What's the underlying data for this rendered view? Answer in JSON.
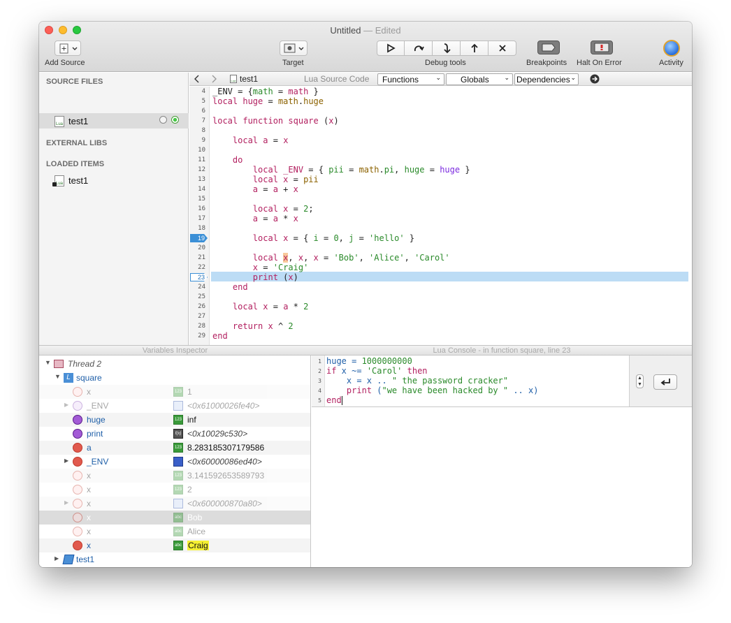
{
  "window": {
    "title": "Untitled",
    "title_sep": " — ",
    "title_status": "Edited"
  },
  "toolbar": {
    "add_source": "Add Source",
    "target": "Target",
    "debug_tools": "Debug tools",
    "breakpoints": "Breakpoints",
    "halt_on_error": "Halt On Error",
    "activity": "Activity"
  },
  "sidebar": {
    "source_files_header": "SOURCE FILES",
    "source_file": "test1",
    "external_libs_header": "EXTERNAL LIBS",
    "loaded_items_header": "LOADED ITEMS",
    "loaded_item": "test1"
  },
  "editor_bar": {
    "file_name": "test1",
    "language": "Lua Source Code",
    "functions": "Functions",
    "globals": "Globals",
    "dependencies": "Dependencies"
  },
  "editor": {
    "line_numbers": [
      "4",
      "5",
      "6",
      "7",
      "8",
      "9",
      "10",
      "11",
      "12",
      "13",
      "14",
      "15",
      "16",
      "17",
      "18",
      "19",
      "20",
      "21",
      "22",
      "23",
      "24",
      "25",
      "26",
      "27",
      "28",
      "29"
    ],
    "breakpoint_line": "19",
    "current_line": "23"
  },
  "panels": {
    "variables_inspector": "Variables Inspector",
    "console_title": "Lua Console - in function square, line 23"
  },
  "variables": {
    "thread": "Thread 2",
    "function": "square",
    "rows": [
      {
        "name": "x",
        "value": "1"
      },
      {
        "name": "_ENV",
        "value": "<0x61000026fe40>"
      },
      {
        "name": "huge",
        "value": "inf"
      },
      {
        "name": "print",
        "value": "<0x10029c530>"
      },
      {
        "name": "a",
        "value": "8.283185307179586"
      },
      {
        "name": "_ENV",
        "value": "<0x60000086ed40>"
      },
      {
        "name": "x",
        "value": "3.141592653589793"
      },
      {
        "name": "x",
        "value": "2"
      },
      {
        "name": "x",
        "value": "<0x600000870a80>"
      },
      {
        "name": "x",
        "value": "Bob"
      },
      {
        "name": "x",
        "value": "Alice"
      },
      {
        "name": "x",
        "value": "Craig"
      }
    ],
    "chunk": "test1"
  },
  "console": {
    "line_numbers": [
      "1",
      "2",
      "3",
      "4",
      "5"
    ]
  },
  "colors": {
    "accent": "#3b8fd6",
    "current_line": "#bcdcf5",
    "keyword": "#b21f5f"
  }
}
